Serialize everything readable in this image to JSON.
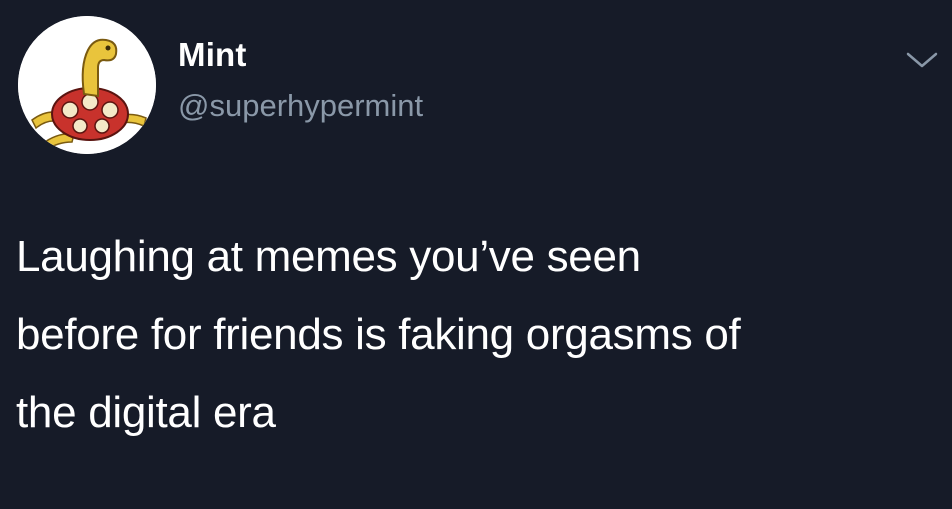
{
  "tweet": {
    "author": {
      "name": "Mint",
      "handle": "@superhypermint",
      "avatar_icon": "shuckle-avatar-icon"
    },
    "menu_icon": "chevron-down-icon",
    "text_lines": [
      "Laughing at memes you’ve seen",
      "before for friends is faking orgasms of",
      "the digital era"
    ]
  },
  "colors": {
    "background": "#161b28",
    "text": "#ffffff",
    "handle": "#8a98a8",
    "chevron": "#8a98a8"
  }
}
